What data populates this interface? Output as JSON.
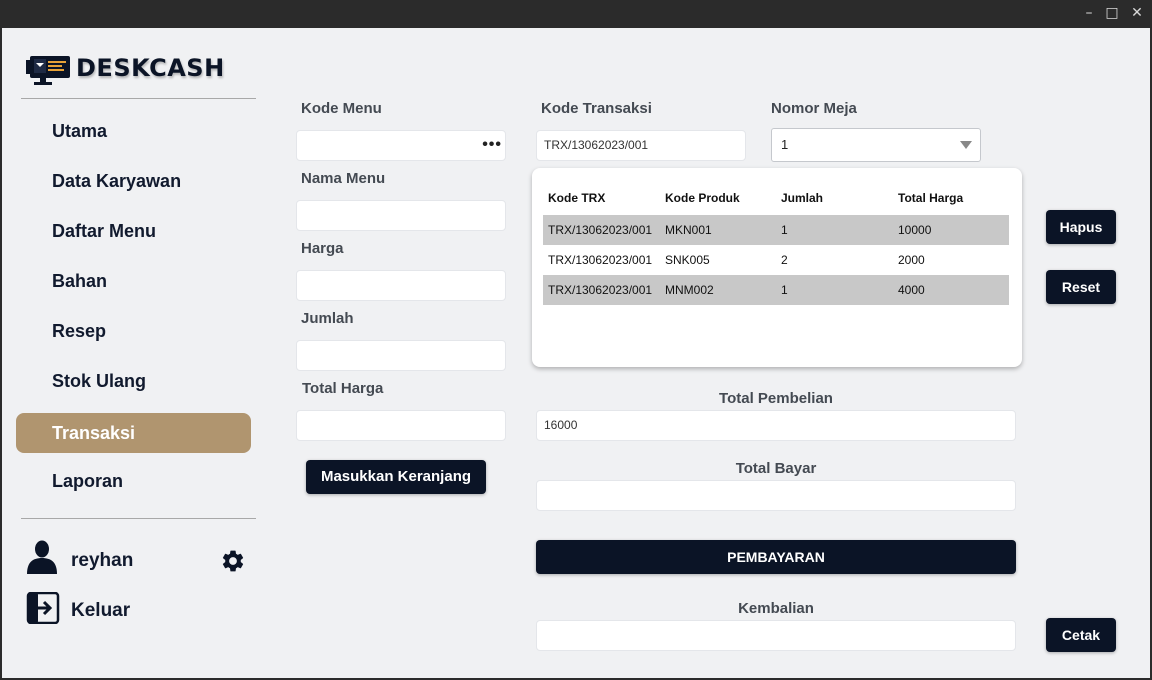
{
  "window": {
    "minimize_icon": "minimize-icon",
    "maximize_icon": "maximize-icon",
    "close_icon": "close-icon"
  },
  "app": {
    "brand": "DESKCASH",
    "accent_color": "#b0956f",
    "primary_color": "#0b1426"
  },
  "sidebar": {
    "items": [
      {
        "label": "Utama"
      },
      {
        "label": "Data Karyawan"
      },
      {
        "label": "Daftar Menu"
      },
      {
        "label": "Bahan"
      },
      {
        "label": "Resep"
      },
      {
        "label": "Stok Ulang"
      },
      {
        "label": "Transaksi",
        "active": true
      },
      {
        "label": "Laporan"
      }
    ],
    "user": {
      "name": "reyhan"
    },
    "logout_label": "Keluar"
  },
  "form": {
    "kode_menu_label": "Kode Menu",
    "kode_menu_value": "",
    "nama_menu_label": "Nama Menu",
    "nama_menu_value": "",
    "harga_label": "Harga",
    "harga_value": "",
    "jumlah_label": "Jumlah",
    "jumlah_value": "",
    "total_harga_label": "Total Harga",
    "total_harga_value": "",
    "add_to_cart_label": "Masukkan Keranjang"
  },
  "transaction": {
    "kode_transaksi_label": "Kode Transaksi",
    "kode_transaksi_value": "TRX/13062023/001",
    "nomor_meja_label": "Nomor Meja",
    "nomor_meja_value": "1"
  },
  "table": {
    "headers": [
      "Kode TRX",
      "Kode Produk",
      "Jumlah",
      "Total Harga"
    ],
    "rows": [
      [
        "TRX/13062023/001",
        "MKN001",
        "1",
        "10000"
      ],
      [
        "TRX/13062023/001",
        "SNK005",
        "2",
        "2000"
      ],
      [
        "TRX/13062023/001",
        "MNM002",
        "1",
        "4000"
      ]
    ]
  },
  "actions": {
    "hapus_label": "Hapus",
    "reset_label": "Reset",
    "cetak_label": "Cetak"
  },
  "payment": {
    "total_pembelian_label": "Total Pembelian",
    "total_pembelian_value": "16000",
    "total_bayar_label": "Total Bayar",
    "total_bayar_value": "",
    "pay_button_label": "PEMBAYARAN",
    "kembalian_label": "Kembalian",
    "kembalian_value": ""
  }
}
